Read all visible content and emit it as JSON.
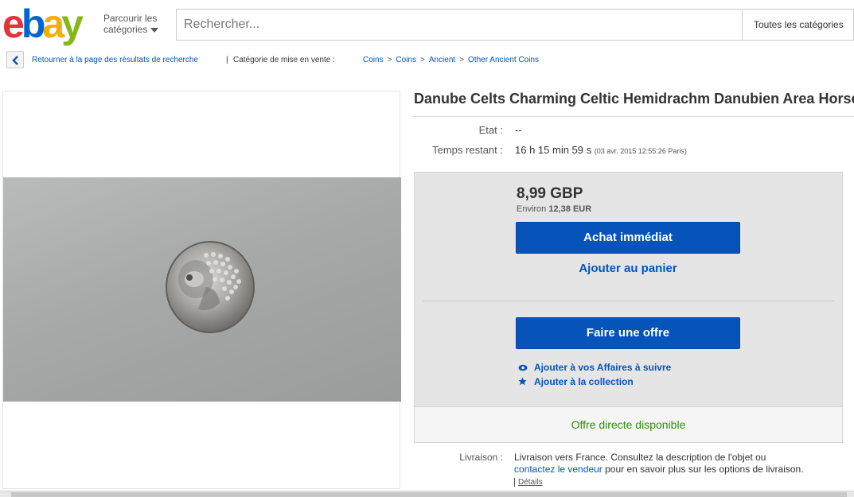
{
  "header": {
    "logo": {
      "e": "e",
      "b": "b",
      "a": "a",
      "y": "y"
    },
    "browse_line1": "Parcourir les",
    "browse_line2": "catégories",
    "search_placeholder": "Rechercher...",
    "all_categories": "Toutes les catégories"
  },
  "breadcrumb": {
    "back_text": "Retourner à la page des résultats de recherche",
    "separator": "|",
    "category_label": "Catégorie de mise en vente :",
    "crumbs": [
      "Coins",
      "Coins",
      "Ancient",
      "Other Ancient Coins"
    ],
    "arrow": ">"
  },
  "item": {
    "title": "Danube Celts Charming Celtic Hemidrachm Danubien Area Horse",
    "condition_label": "Etat :",
    "condition_value": "--",
    "time_label": "Temps restant :",
    "time_value": "16 h 15 min 59 s",
    "time_detail": "(03 avr. 2015   12:55:26 Paris)"
  },
  "buybox": {
    "price": "8,99 GBP",
    "approx_prefix": "Environ",
    "approx_value": "12,38 EUR",
    "buy_now": "Achat immédiat",
    "add_to_cart": "Ajouter au panier",
    "make_offer": "Faire une offre",
    "watch": "Ajouter à vos Affaires à suivre",
    "collection": "Ajouter à la collection",
    "direct_offer": "Offre directe disponible"
  },
  "shipping": {
    "label": "Livraison :",
    "text1": "Livraison vers France. Consultez la description de l'objet ou",
    "link": "contactez le vendeur",
    "text2": "pour en savoir plus sur les options de livraison.",
    "details": "Détails"
  },
  "colors": {
    "ebay_red": "#e53238",
    "ebay_blue": "#0654ba",
    "ebay_yellow": "#f5af02",
    "ebay_green": "#86b817",
    "offer_green": "#2d8f06"
  }
}
